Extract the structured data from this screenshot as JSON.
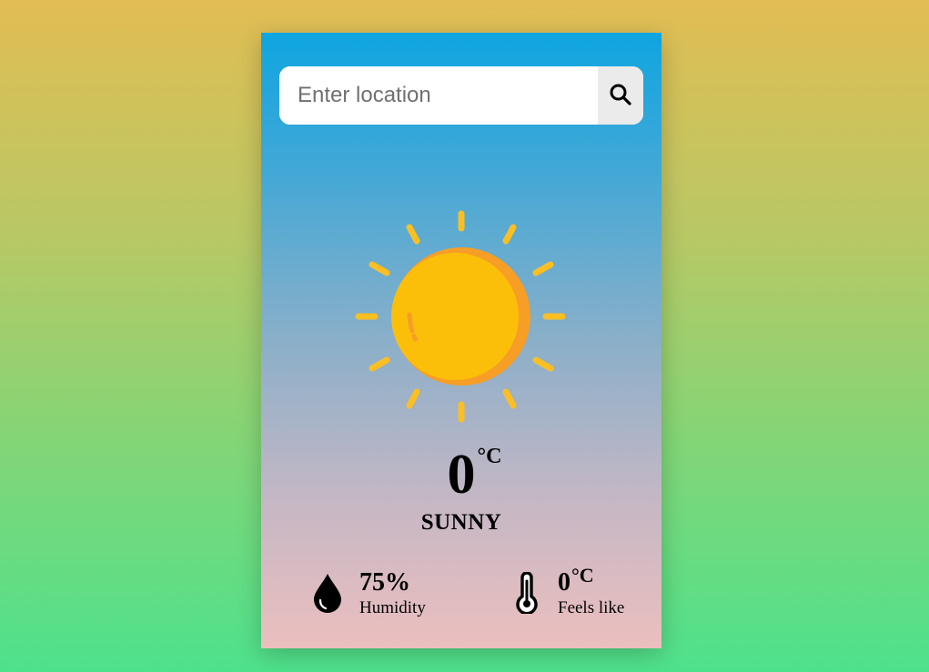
{
  "search": {
    "placeholder": "Enter location",
    "value": ""
  },
  "weather": {
    "icon": "sun-icon",
    "temperature": "0",
    "temperature_unit": "°C",
    "condition": "SUNNY"
  },
  "details": {
    "humidity": {
      "icon": "water-drop-icon",
      "value": "75%",
      "label": "Humidity"
    },
    "feels_like": {
      "icon": "thermometer-icon",
      "value": "0",
      "unit": "°C",
      "label": "Feels like"
    }
  },
  "colors": {
    "sun_core": "#fbbf0a",
    "sun_shadow": "#f69e26",
    "sun_rays": "#fbbf24"
  }
}
